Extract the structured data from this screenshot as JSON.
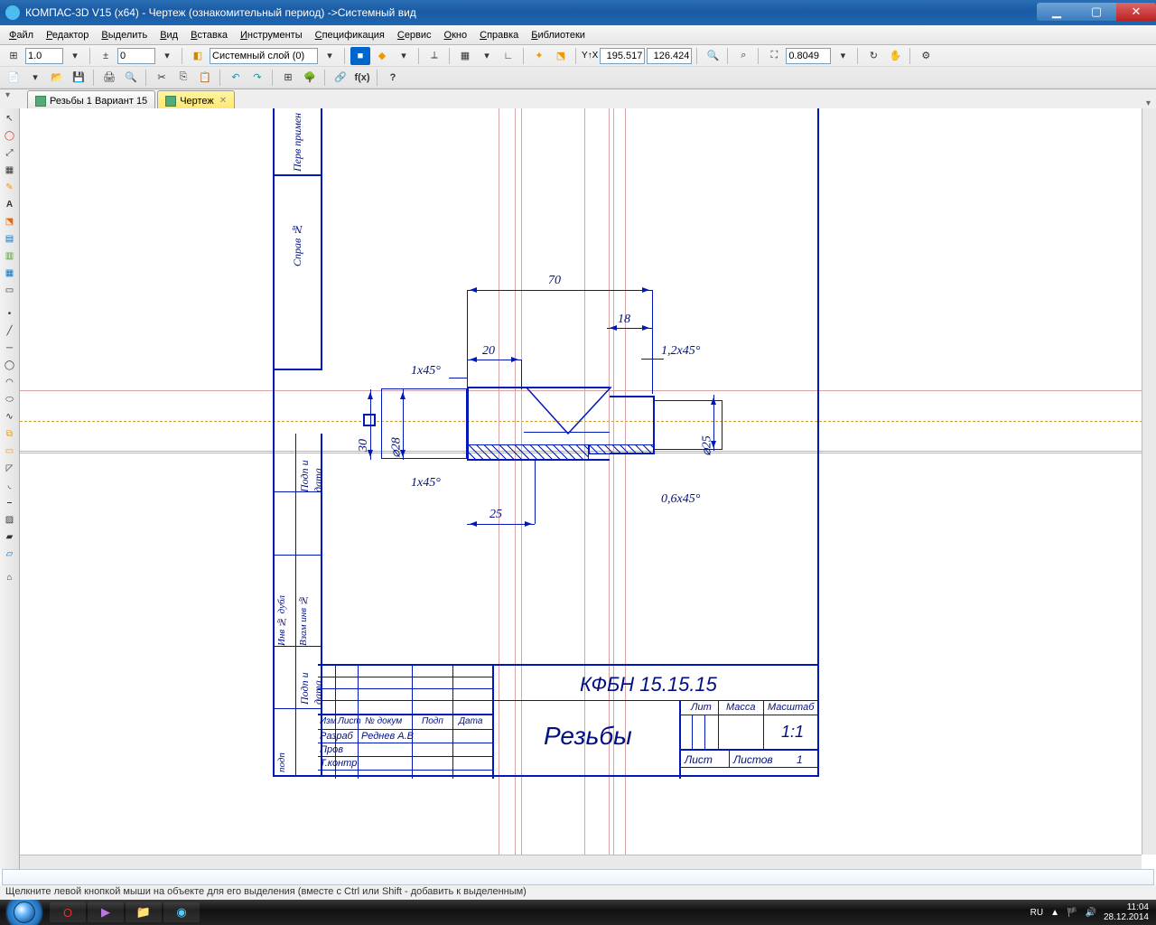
{
  "title": "КОМПАС-3D V15 (x64) - Чертеж (ознакомительный период) ->Системный вид",
  "menu": [
    "Файл",
    "Редактор",
    "Выделить",
    "Вид",
    "Вставка",
    "Инструменты",
    "Спецификация",
    "Сервис",
    "Окно",
    "Справка",
    "Библиотеки"
  ],
  "toolbar": {
    "scale": "1.0",
    "step": "0",
    "layer": "Системный слой (0)",
    "coord_x": "195.517",
    "coord_y": "126.424",
    "zoom": "0.8049"
  },
  "tabs": [
    {
      "label": "Резьбы 1 Вариант 15",
      "active": false
    },
    {
      "label": "Чертеж",
      "active": true
    }
  ],
  "drawing": {
    "dims": {
      "d70": "70",
      "d18": "18",
      "d20": "20",
      "c1": "1,2x45°",
      "c2": "1x45°",
      "c3": "1x45°",
      "c4": "0,6x45°",
      "d25": "25",
      "dia28": "⌀28",
      "dia25": "⌀25",
      "h30": "30"
    },
    "titleblock": {
      "code": "КФБН 15.15.15",
      "name": "Резьбы",
      "row_hdr": [
        "Изм",
        "Лист",
        "№ докум",
        "Подп",
        "Дата"
      ],
      "rows": [
        "Разраб",
        "Пров",
        "Т.контр"
      ],
      "dev_name": "Реднев А.В",
      "cols": [
        "Лит",
        "Масса",
        "Масштаб"
      ],
      "scale": "1:1",
      "sheet": "Лист",
      "sheets": "Листов",
      "sheets_n": "1"
    },
    "side_labels": [
      "Перв примен",
      "Справ №",
      "Подп и дата",
      "Взам инв №",
      "Инв № дубл",
      "Подп и дата",
      "подп"
    ]
  },
  "status": "Щелкните левой кнопкой мыши на объекте для его выделения (вместе с Ctrl или Shift - добавить к выделенным)",
  "tray": {
    "lang": "RU",
    "time": "11:04",
    "date": "28.12.2014"
  }
}
